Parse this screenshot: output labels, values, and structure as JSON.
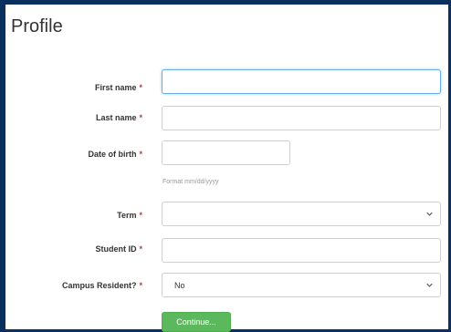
{
  "page": {
    "title": "Profile"
  },
  "form": {
    "required_marker": "*",
    "first_name": {
      "label": "First name",
      "value": ""
    },
    "last_name": {
      "label": "Last name",
      "value": ""
    },
    "dob": {
      "label": "Date of birth",
      "value": "",
      "hint": "Format mm/dd/yyyy"
    },
    "term": {
      "label": "Term",
      "selected": ""
    },
    "student_id": {
      "label": "Student ID",
      "value": ""
    },
    "campus_resident": {
      "label": "Campus Resident?",
      "selected": "No"
    },
    "continue_label": "Continue..."
  },
  "colors": {
    "background": "#0b2f5e",
    "button": "#5cb85c",
    "required": "#a94442"
  },
  "icons": {
    "select_arrow": "chevron-down-icon"
  }
}
